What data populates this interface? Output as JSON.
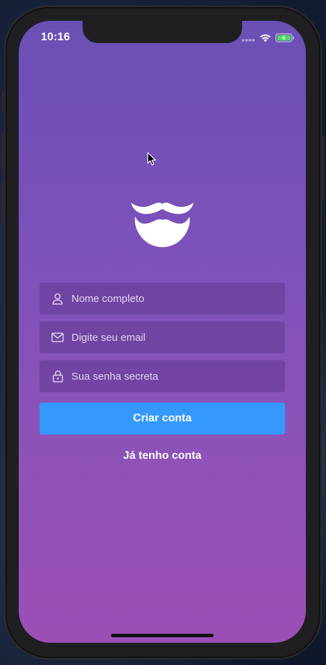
{
  "status_bar": {
    "time": "10:16",
    "icons": [
      "signal-dots-icon",
      "wifi-icon",
      "battery-charging-icon"
    ],
    "battery_color": "#4cd964"
  },
  "logo": {
    "icon": "mustache-beard-icon",
    "color": "#ffffff"
  },
  "form": {
    "name_field": {
      "icon": "user-icon",
      "placeholder": "Nome completo",
      "value": ""
    },
    "email_field": {
      "icon": "mail-icon",
      "placeholder": "Digite seu email",
      "value": ""
    },
    "password_field": {
      "icon": "lock-icon",
      "placeholder": "Sua senha secreta",
      "value": ""
    },
    "submit_label": "Criar conta",
    "submit_color": "#3499fb",
    "signin_label": "Já tenho conta"
  },
  "theme": {
    "gradient_top": "#6a50b5",
    "gradient_bottom": "#9b4fb7"
  }
}
